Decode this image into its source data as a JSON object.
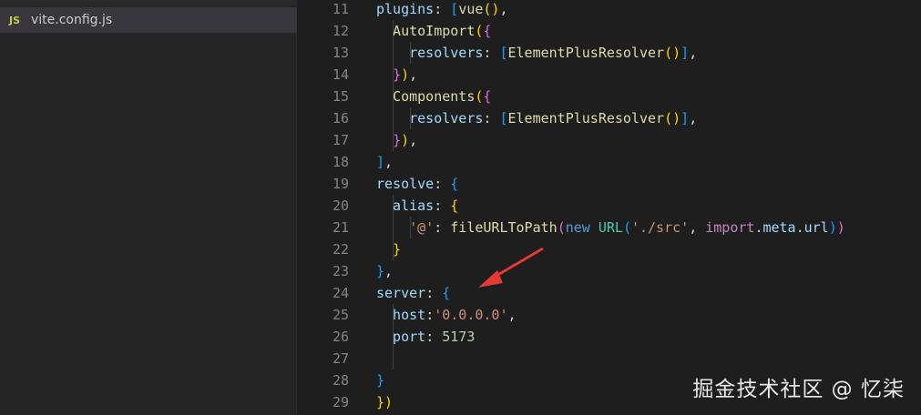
{
  "sidebar": {
    "file": {
      "icon_label": "JS",
      "name": "vite.config.js"
    }
  },
  "editor": {
    "lines": [
      {
        "n": "11",
        "tokens": [
          {
            "t": "plugins",
            "c": "c-prop"
          },
          {
            "t": ": ",
            "c": "c-punc"
          },
          {
            "t": "[",
            "c": "b3"
          },
          {
            "t": "vue",
            "c": "c-fn"
          },
          {
            "t": "()",
            "c": "b1"
          },
          {
            "t": ",",
            "c": "c-punc"
          }
        ]
      },
      {
        "n": "12",
        "tokens": [
          {
            "t": "  AutoImport",
            "c": "c-fn"
          },
          {
            "t": "(",
            "c": "b1"
          },
          {
            "t": "{",
            "c": "b2"
          }
        ]
      },
      {
        "n": "13",
        "tokens": [
          {
            "t": "    resolvers",
            "c": "c-prop"
          },
          {
            "t": ": ",
            "c": "c-punc"
          },
          {
            "t": "[",
            "c": "b3"
          },
          {
            "t": "ElementPlusResolver",
            "c": "c-fn"
          },
          {
            "t": "()",
            "c": "b1"
          },
          {
            "t": "]",
            "c": "b3"
          },
          {
            "t": ",",
            "c": "c-punc"
          }
        ]
      },
      {
        "n": "14",
        "tokens": [
          {
            "t": "  ",
            "c": "c-punc"
          },
          {
            "t": "}",
            "c": "b2"
          },
          {
            "t": ")",
            "c": "b1"
          },
          {
            "t": ",",
            "c": "c-punc"
          }
        ]
      },
      {
        "n": "15",
        "tokens": [
          {
            "t": "  Components",
            "c": "c-fn"
          },
          {
            "t": "(",
            "c": "b1"
          },
          {
            "t": "{",
            "c": "b2"
          }
        ]
      },
      {
        "n": "16",
        "tokens": [
          {
            "t": "    resolvers",
            "c": "c-prop"
          },
          {
            "t": ": ",
            "c": "c-punc"
          },
          {
            "t": "[",
            "c": "b3"
          },
          {
            "t": "ElementPlusResolver",
            "c": "c-fn"
          },
          {
            "t": "()",
            "c": "b1"
          },
          {
            "t": "]",
            "c": "b3"
          },
          {
            "t": ",",
            "c": "c-punc"
          }
        ]
      },
      {
        "n": "17",
        "tokens": [
          {
            "t": "  ",
            "c": "c-punc"
          },
          {
            "t": "}",
            "c": "b2"
          },
          {
            "t": ")",
            "c": "b1"
          },
          {
            "t": ",",
            "c": "c-punc"
          }
        ]
      },
      {
        "n": "18",
        "tokens": [
          {
            "t": "]",
            "c": "b3"
          },
          {
            "t": ",",
            "c": "c-punc"
          }
        ]
      },
      {
        "n": "19",
        "tokens": [
          {
            "t": "resolve",
            "c": "c-prop"
          },
          {
            "t": ": ",
            "c": "c-punc"
          },
          {
            "t": "{",
            "c": "b3"
          }
        ]
      },
      {
        "n": "20",
        "tokens": [
          {
            "t": "  alias",
            "c": "c-prop"
          },
          {
            "t": ": ",
            "c": "c-punc"
          },
          {
            "t": "{",
            "c": "b1"
          }
        ]
      },
      {
        "n": "21",
        "tokens": [
          {
            "t": "    '@'",
            "c": "c-str"
          },
          {
            "t": ": ",
            "c": "c-punc"
          },
          {
            "t": "fileURLToPath",
            "c": "c-fn"
          },
          {
            "t": "(",
            "c": "b2"
          },
          {
            "t": "new ",
            "c": "c-kw"
          },
          {
            "t": "URL",
            "c": "c-cls"
          },
          {
            "t": "(",
            "c": "b3"
          },
          {
            "t": "'./src'",
            "c": "c-str"
          },
          {
            "t": ", ",
            "c": "c-punc"
          },
          {
            "t": "import",
            "c": "c-kw2"
          },
          {
            "t": ".meta.url",
            "c": "c-prop"
          },
          {
            "t": ")",
            "c": "b3"
          },
          {
            "t": ")",
            "c": "b2"
          }
        ]
      },
      {
        "n": "22",
        "tokens": [
          {
            "t": "  }",
            "c": "b1"
          }
        ]
      },
      {
        "n": "23",
        "tokens": [
          {
            "t": "}",
            "c": "b3"
          },
          {
            "t": ",",
            "c": "c-punc"
          }
        ]
      },
      {
        "n": "24",
        "tokens": [
          {
            "t": "server",
            "c": "c-prop"
          },
          {
            "t": ": ",
            "c": "c-punc"
          },
          {
            "t": "{",
            "c": "b3"
          }
        ]
      },
      {
        "n": "25",
        "tokens": [
          {
            "t": "  host",
            "c": "c-prop"
          },
          {
            "t": ":",
            "c": "c-punc"
          },
          {
            "t": "'0.0.0.0'",
            "c": "c-str"
          },
          {
            "t": ",",
            "c": "c-punc"
          }
        ]
      },
      {
        "n": "26",
        "tokens": [
          {
            "t": "  port",
            "c": "c-prop"
          },
          {
            "t": ": ",
            "c": "c-punc"
          },
          {
            "t": "5173",
            "c": "c-num"
          }
        ]
      },
      {
        "n": "27",
        "tokens": []
      },
      {
        "n": "28",
        "tokens": [
          {
            "t": "}",
            "c": "b3"
          }
        ]
      },
      {
        "n": "29",
        "tokens": [
          {
            "t": "})",
            "c": "b1"
          }
        ]
      }
    ]
  },
  "watermark": "掘金技术社区 @ 忆柒",
  "colors": {
    "annotation_arrow": "#e53935"
  }
}
